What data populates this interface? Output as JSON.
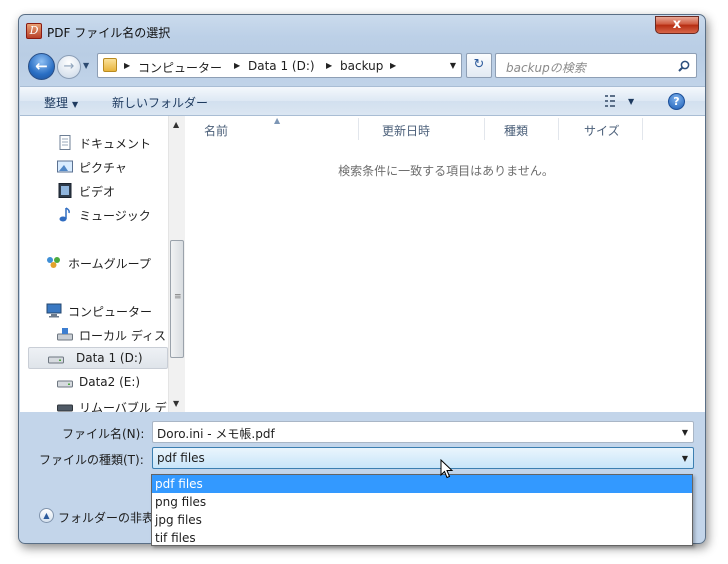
{
  "window": {
    "title": "PDF ファイル名の選択",
    "close_label": "x",
    "app_icon_glyph": "D"
  },
  "navigation": {
    "back_glyph": "←",
    "forward_glyph": "→",
    "breadcrumbs": [
      "コンピューター",
      "Data 1 (D:)",
      "backup"
    ],
    "refresh_glyph": "↻",
    "search_placeholder": "backupの検索"
  },
  "toolbar": {
    "organize_label": "整理",
    "new_folder_label": "新しいフォルダー",
    "help_glyph": "?"
  },
  "nav_pane": {
    "items": [
      {
        "label": "ドキュメント",
        "icon": "documents-icon"
      },
      {
        "label": "ピクチャ",
        "icon": "pictures-icon"
      },
      {
        "label": "ビデオ",
        "icon": "videos-icon"
      },
      {
        "label": "ミュージック",
        "icon": "music-icon"
      },
      {
        "label": "ホームグループ",
        "icon": "homegroup-icon"
      },
      {
        "label": "コンピューター",
        "icon": "computer-icon"
      },
      {
        "label": "ローカル ディス",
        "icon": "local-disk-icon"
      },
      {
        "label": "Data 1 (D:)",
        "icon": "drive-icon",
        "selected": true
      },
      {
        "label": "Data2 (E:)",
        "icon": "drive-icon"
      },
      {
        "label": "リムーバブル デ",
        "icon": "removable-drive-icon"
      }
    ]
  },
  "file_list": {
    "columns": [
      "名前",
      "更新日時",
      "種類",
      "サイズ"
    ],
    "empty_message": "検索条件に一致する項目はありません。"
  },
  "form": {
    "filename_label": "ファイル名(N):",
    "filename_value": "Doro.ini - メモ帳.pdf",
    "filetype_label": "ファイルの種類(T):",
    "filetype_value": "pdf files",
    "filetype_options": [
      "pdf files",
      "png files",
      "jpg files",
      "tif files"
    ],
    "filetype_selected_index": 0,
    "hide_folders_label": "フォルダーの非表"
  },
  "colors": {
    "selection": "#3399ff",
    "chrome": "#bcd0e7",
    "close": "#c8442c"
  }
}
